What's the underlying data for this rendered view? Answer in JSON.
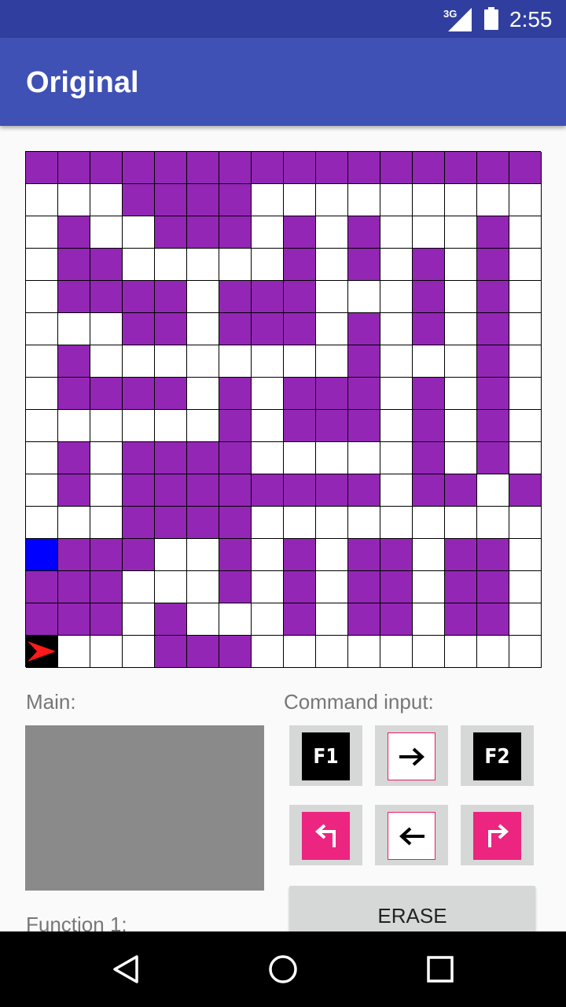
{
  "status_bar": {
    "network": "3G",
    "time": "2:55"
  },
  "app_bar": {
    "title": "Original"
  },
  "grid": {
    "rows": [
      "pppppppppppppppp",
      "...pppp.........",
      ".p..ppp.p.p...p.",
      ".pp.....p.p.p.p.",
      ".pppp.ppp...p.p.",
      "...pp.ppp.p.p.p.",
      ".p........p...p.",
      ".pppp.p.ppp.p.p.",
      "......p.ppp.p.p.",
      ".p.pppp.....p.p.",
      ".p.pppppppp.pp.p",
      "...pppp.........",
      "bppp..p.p.pp.pp.",
      "ppp...p.p.pp.pp.",
      "ppp.p...p.pp.pp.",
      "r...ppp........."
    ],
    "colors": {
      "p": "#9426b5",
      "b": "#0000ff",
      "r": "#000000",
      ".": "#ffffff"
    },
    "player_icon": "red-arrow-right-icon"
  },
  "main": {
    "label": "Main:"
  },
  "function1": {
    "label": "Function 1:"
  },
  "commands": {
    "label": "Command input:",
    "f1": "F1",
    "f2": "F2",
    "forward_icon": "arrow-right-icon",
    "back_icon": "arrow-left-icon",
    "turn_left_icon": "turn-left-icon",
    "turn_right_icon": "turn-right-icon",
    "erase": "ERASE"
  },
  "nav": {
    "back": "back-icon",
    "home": "home-icon",
    "recents": "recents-icon"
  }
}
